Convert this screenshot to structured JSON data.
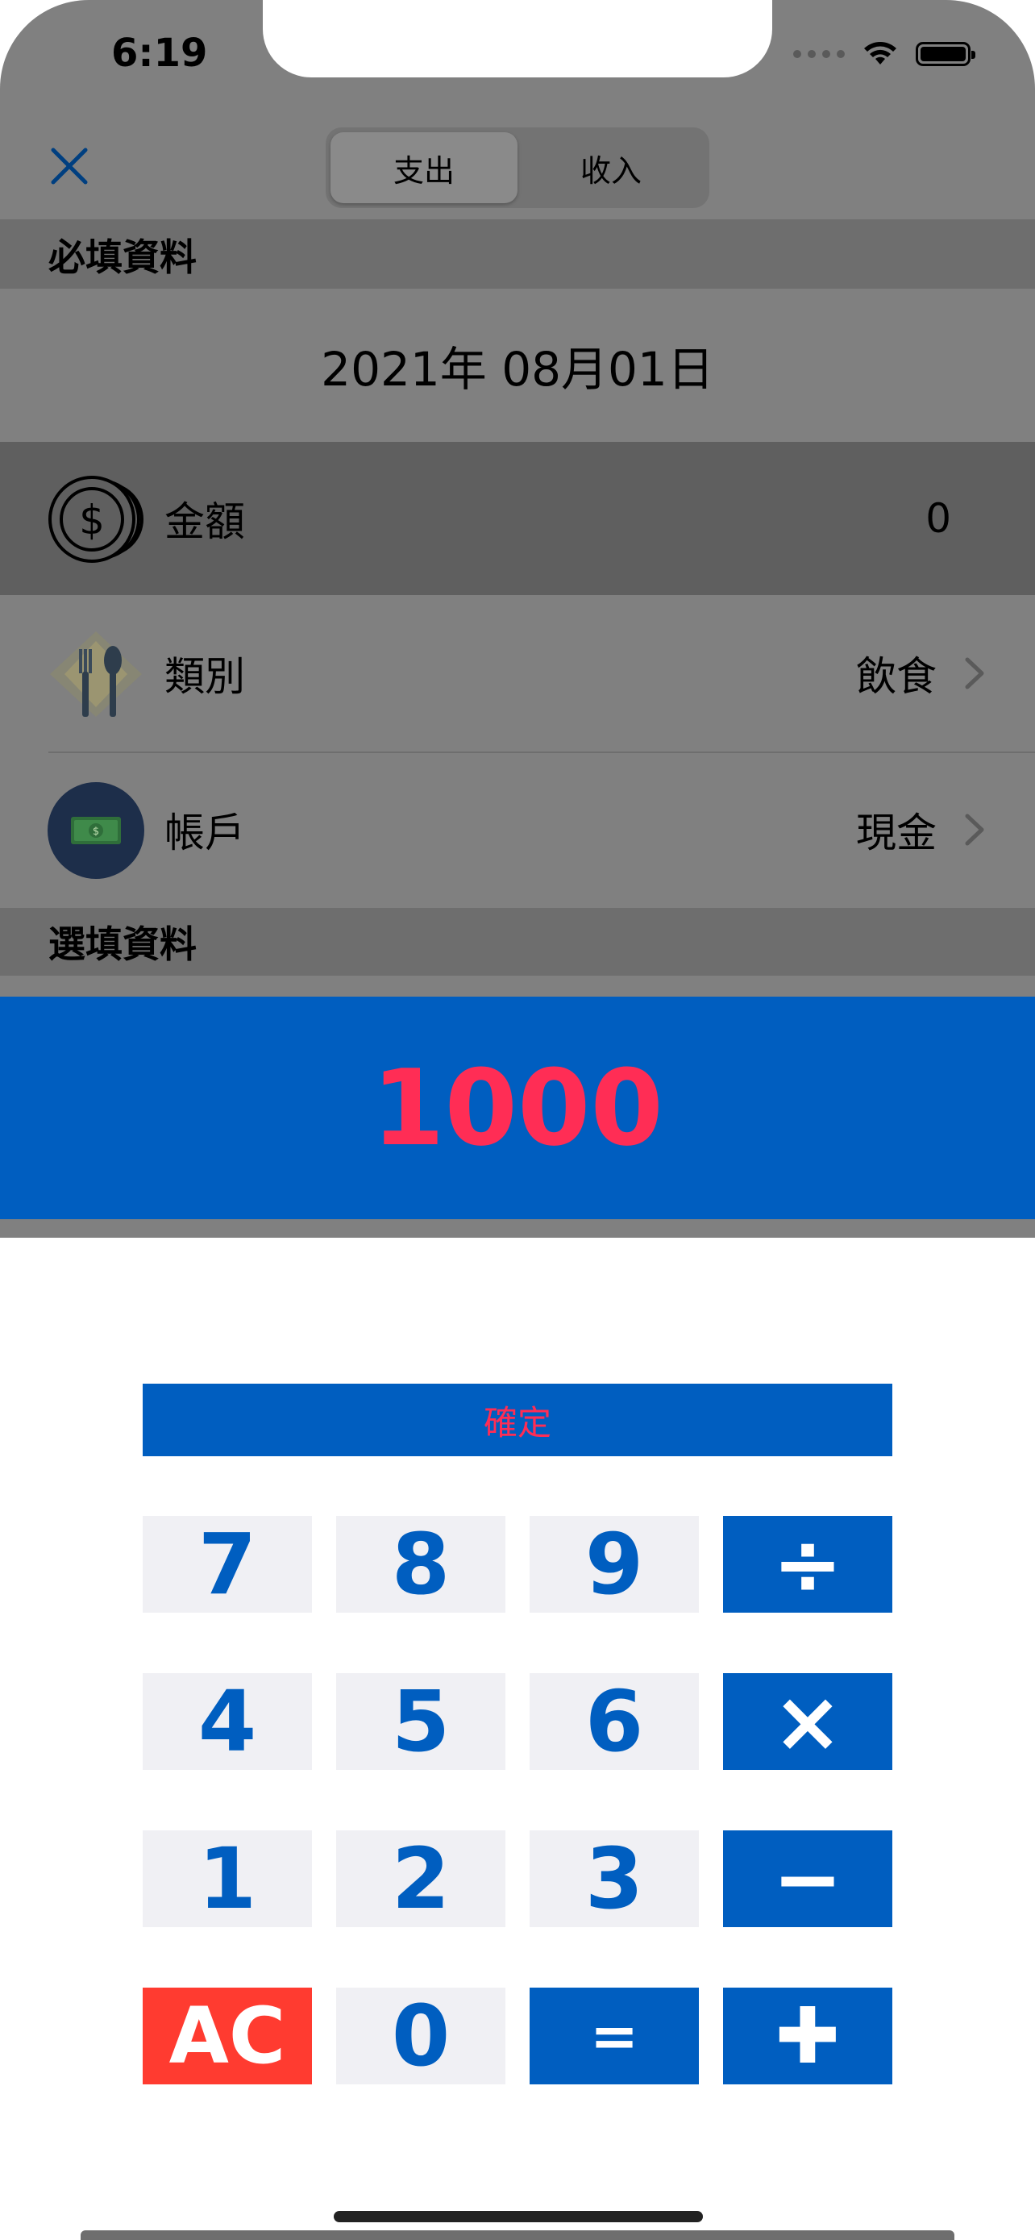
{
  "status_bar": {
    "time": "6:19"
  },
  "nav": {
    "close_icon": "close-x-icon",
    "segments": [
      "支出",
      "收入"
    ],
    "selected_segment": "支出"
  },
  "required_section": {
    "header": "必填資料",
    "date": "2021年 08月01日",
    "amount": {
      "label": "金額",
      "value": "0",
      "icon": "coins-dollar-icon"
    },
    "category": {
      "label": "類別",
      "value": "飲食",
      "icon": "fork-spoon-icon"
    },
    "account": {
      "label": "帳戶",
      "value": "現金",
      "icon": "cash-money-icon"
    }
  },
  "optional_section": {
    "header": "選填資料"
  },
  "calculator": {
    "display": "1000",
    "confirm_label": "確定",
    "keys": {
      "k7": "7",
      "k8": "8",
      "k9": "9",
      "divide": "÷",
      "k4": "4",
      "k5": "5",
      "k6": "6",
      "multiply": "×",
      "k1": "1",
      "k2": "2",
      "k3": "3",
      "minus": "−",
      "ac": "AC",
      "k0": "0",
      "equals": "=",
      "plus": "✚"
    }
  },
  "colors": {
    "accent_blue": "#005ec0",
    "highlight_red": "#ff2d55",
    "ac_red": "#ff3b30",
    "key_gray": "#f0f0f4",
    "dim_overlay": "#808080"
  }
}
